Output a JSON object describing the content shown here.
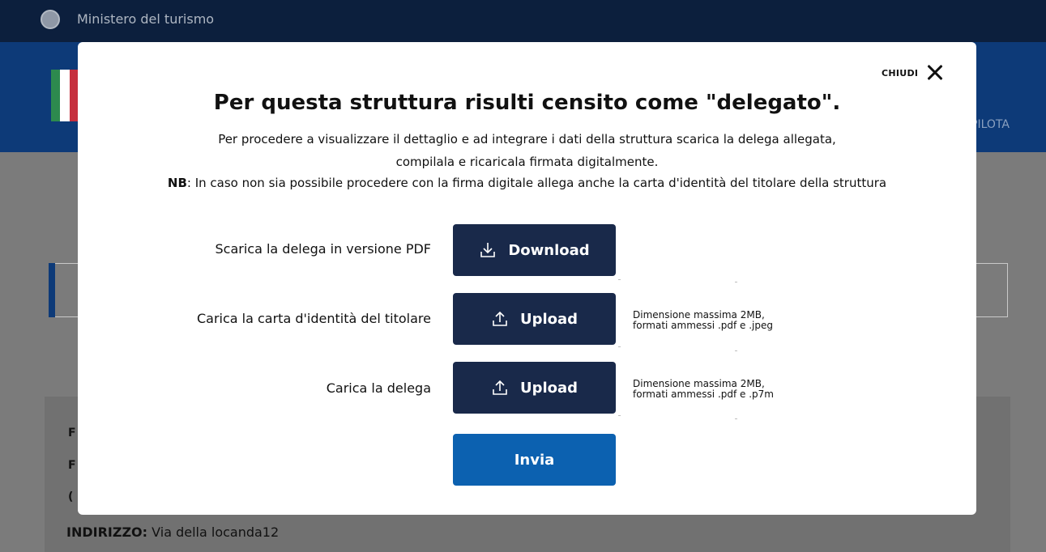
{
  "background": {
    "ministry": "Ministero del turismo",
    "nav_fragment": "PILOTA",
    "address_label": "INDIRIZZO:",
    "address_value": "Via della locanda12",
    "row_fragments": [
      "F",
      "F",
      "("
    ]
  },
  "modal": {
    "close_label": "CHIUDI",
    "title": "Per questa struttura risulti censito come \"delegato\".",
    "description_line1": "Per procedere a visualizzare il dettaglio e ad integrare i dati della struttura scarica la delega allegata,",
    "description_line2": "compilala e ricaricala firmata digitalmente.",
    "nb_label": "NB",
    "nb_text": ": In caso non sia possibile procedere con la firma digitale allega anche la carta d'identità del titolare della struttura",
    "rows": [
      {
        "label": "Scarica la delega in versione PDF",
        "button": "Download",
        "icon": "download-icon"
      },
      {
        "label": "Carica la carta d'identità del titolare",
        "button": "Upload",
        "icon": "upload-icon",
        "hint1": "Dimensione massima 2MB,",
        "hint2": "formati ammessi .pdf e .jpeg"
      },
      {
        "label": "Carica la delega",
        "button": "Upload",
        "icon": "upload-icon",
        "hint1": "Dimensione massima 2MB,",
        "hint2": "formati ammessi .pdf e .p7m"
      }
    ],
    "submit": "Invia"
  },
  "colors": {
    "topbar": "#0c1f3d",
    "header": "#0d3a78",
    "overlay": "#7b7b7b",
    "button_dark": "#19294a",
    "button_primary": "#0c61b0"
  }
}
